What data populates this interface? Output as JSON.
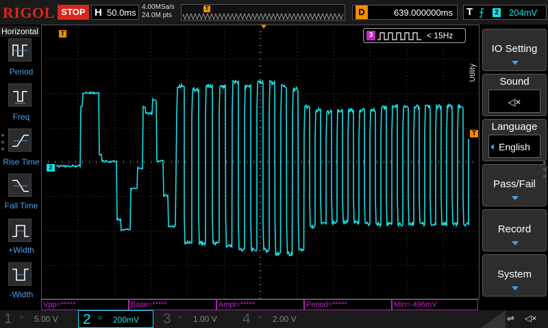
{
  "topbar": {
    "brand": "RIGOL",
    "run_state": "STOP",
    "timebase_label": "H",
    "timebase_value": "50.0ms",
    "sample_rate": "4.00MSa/s",
    "memory_depth": "24.0M pts",
    "delay_label": "D",
    "delay_value": "639.000000ms",
    "trigger_label": "T",
    "trigger_source": "2",
    "trigger_level": "204mV"
  },
  "left_panel": {
    "title": "Horizontal",
    "items": [
      {
        "label": "Period",
        "icon": "period-icon"
      },
      {
        "label": "Freq",
        "icon": "freq-icon"
      },
      {
        "label": "Rise Time",
        "icon": "rise-time-icon"
      },
      {
        "label": "Fall Time",
        "icon": "fall-time-icon"
      },
      {
        "label": "+Width",
        "icon": "positive-width-icon"
      },
      {
        "label": "-Width",
        "icon": "negative-width-icon"
      }
    ]
  },
  "display": {
    "trigger_position_marker": "T",
    "channel_marker": "2",
    "trigger_level_marker": "T",
    "counter": {
      "channel": "3",
      "value": "< 15Hz"
    },
    "trace_color": "#19e0e8"
  },
  "measurements": [
    {
      "text": "Vpp=*****"
    },
    {
      "text": "Base=*****"
    },
    {
      "text": "Ampl=*****"
    },
    {
      "text": "Period=*****"
    },
    {
      "text": "Min=-496mV"
    }
  ],
  "channels": [
    {
      "num": "1",
      "scale": "5.00 V",
      "active": false
    },
    {
      "num": "2",
      "scale": "200mV",
      "active": true
    },
    {
      "num": "3",
      "scale": "1.00 V",
      "active": false
    },
    {
      "num": "4",
      "scale": "2.00 V",
      "active": false
    }
  ],
  "right_menu": {
    "side_label": "Utility",
    "io_setting": "IO Setting",
    "sound": {
      "label": "Sound",
      "value_icon": "speaker-mute-icon"
    },
    "language": {
      "label": "Language",
      "value": "English"
    },
    "pass_fail": "Pass/Fail",
    "record": "Record",
    "system": "System"
  },
  "colors": {
    "brand": "#d9261c",
    "channel2": "#19e0e8",
    "trigger": "#f28c00",
    "measure": "#c426c4",
    "channel3": "#c426c4"
  }
}
